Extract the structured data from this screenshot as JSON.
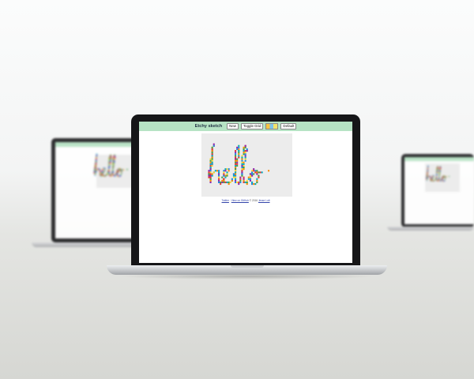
{
  "app": {
    "title": "Etchy sketch",
    "buttons": {
      "new": "New",
      "toggle_grid": "Toggle Grid",
      "default": "Default"
    },
    "color_picker": {
      "swatches": [
        "#f6c443",
        "#7cc3ea",
        "#f1e26a"
      ]
    },
    "canvas": {
      "drawing_text": "hello",
      "background": "#ececec",
      "pixel_colors": [
        "#e53935",
        "#fdd835",
        "#43a047",
        "#1e88e5",
        "#fb8c00",
        "#8e24aa",
        "#00acc1"
      ]
    },
    "footer": {
      "link_1": "Twitter",
      "separator": "·",
      "link_2": "View on GitHub",
      "copyright": "© 2016",
      "link_3": "Jesse Lott"
    }
  },
  "colors": {
    "header_bar": "#b6e3c4",
    "bezel": "#161618",
    "screen": "#ffffff"
  }
}
